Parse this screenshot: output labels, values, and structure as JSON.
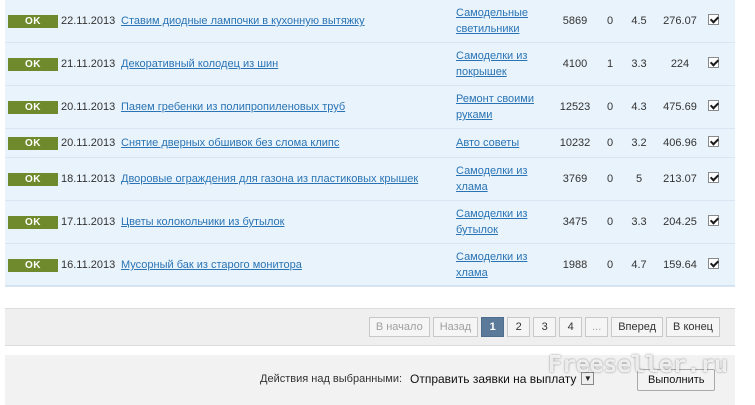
{
  "articles": [
    {
      "status": "OK",
      "date": "22.11.2013",
      "title": "Ставим диодные лампочки в кухонную вытяжку",
      "category_line1": "Самодельные",
      "category_line2": "светильники",
      "views": "5869",
      "comments": "0",
      "rating": "4.5",
      "price": "276.07",
      "checked": true
    },
    {
      "status": "OK",
      "date": "21.11.2013",
      "title": "Декоративный колодец из шин",
      "category_line1": "Самоделки из",
      "category_line2": "покрышек",
      "views": "4100",
      "comments": "1",
      "rating": "3.3",
      "price": "224",
      "checked": true
    },
    {
      "status": "OK",
      "date": "20.11.2013",
      "title": "Паяем гребенки из полипропиленовых труб",
      "category_line1": "Ремонт своими",
      "category_line2": "руками",
      "views": "12523",
      "comments": "0",
      "rating": "4.3",
      "price": "475.69",
      "checked": true
    },
    {
      "status": "OK",
      "date": "20.11.2013",
      "title": "Снятие дверных обшивок без слома клипс",
      "category_line1": "Авто советы",
      "category_line2": "",
      "views": "10232",
      "comments": "0",
      "rating": "3.2",
      "price": "406.96",
      "checked": true
    },
    {
      "status": "OK",
      "date": "18.11.2013",
      "title": "Дворовые ограждения для газона из пластиковых крышек",
      "category_line1": "Самоделки из",
      "category_line2": "хлама",
      "views": "3769",
      "comments": "0",
      "rating": "5",
      "price": "213.07",
      "checked": true
    },
    {
      "status": "OK",
      "date": "17.11.2013",
      "title": "Цветы колокольчики из бутылок",
      "category_line1": "Самоделки из",
      "category_line2": "бутылок",
      "views": "3475",
      "comments": "0",
      "rating": "3.3",
      "price": "204.25",
      "checked": true
    },
    {
      "status": "OK",
      "date": "16.11.2013",
      "title": "Мусорный бак из старого монитора",
      "category_line1": "Самоделки из",
      "category_line2": "хлама",
      "views": "1988",
      "comments": "0",
      "rating": "4.7",
      "price": "159.64",
      "checked": true
    }
  ],
  "pagination": {
    "first": "В начало",
    "prev": "Назад",
    "pages": [
      "1",
      "2",
      "3",
      "4"
    ],
    "current_page": "1",
    "ellipsis": "...",
    "next": "Вперед",
    "last": "В конец"
  },
  "bulk_actions": {
    "label": "Действия над выбранными:",
    "selected_action": "Отправить заявки на выплату",
    "execute_label": "Выполнить"
  },
  "watermark": "Freeseller.ru",
  "colors": {
    "ok_badge": "#6f8a2c",
    "link": "#2a74b5",
    "table_bg": "#e9f3fb",
    "active_page": "#5b7a9a"
  }
}
